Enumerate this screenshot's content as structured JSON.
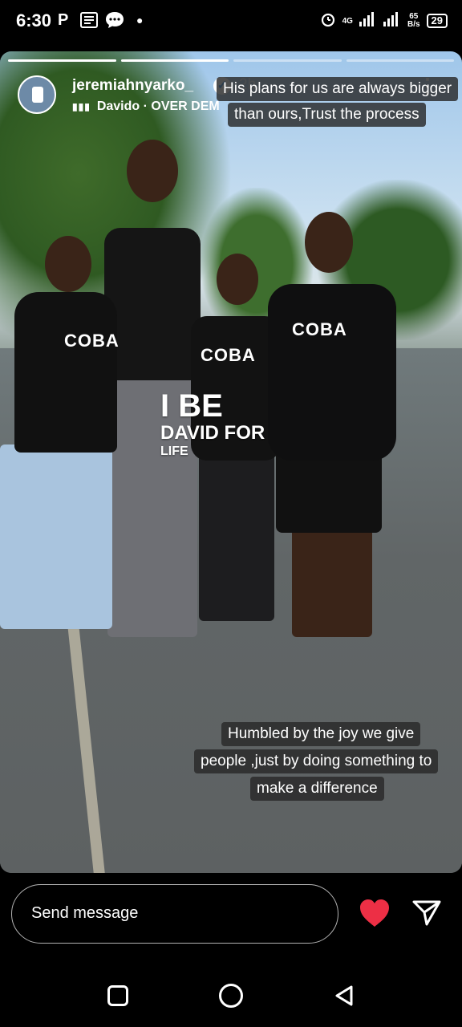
{
  "status_bar": {
    "time": "6:30",
    "net_type": "4G",
    "speed_value": "65",
    "speed_unit": "B/s",
    "battery": "29"
  },
  "story": {
    "progress_segments": 4,
    "progress_current": 2,
    "username": "jeremiahnyarko_",
    "time_ago": "2h",
    "music_text": "Davido · OVER DEM",
    "shirt_logo": "COBA",
    "caption_top": [
      "His plans for us are always bigger",
      "than ours,Trust the process"
    ],
    "overlay_line1": "I BE",
    "overlay_line2": "DAVID FOR",
    "overlay_line3": "LIFE",
    "caption_bottom": [
      "Humbled by the joy we give",
      "people ,just by doing something to",
      "make a difference"
    ]
  },
  "reply": {
    "placeholder": "Send message"
  },
  "colors": {
    "heart": "#ed2f45",
    "caption_bg": "#282828"
  }
}
